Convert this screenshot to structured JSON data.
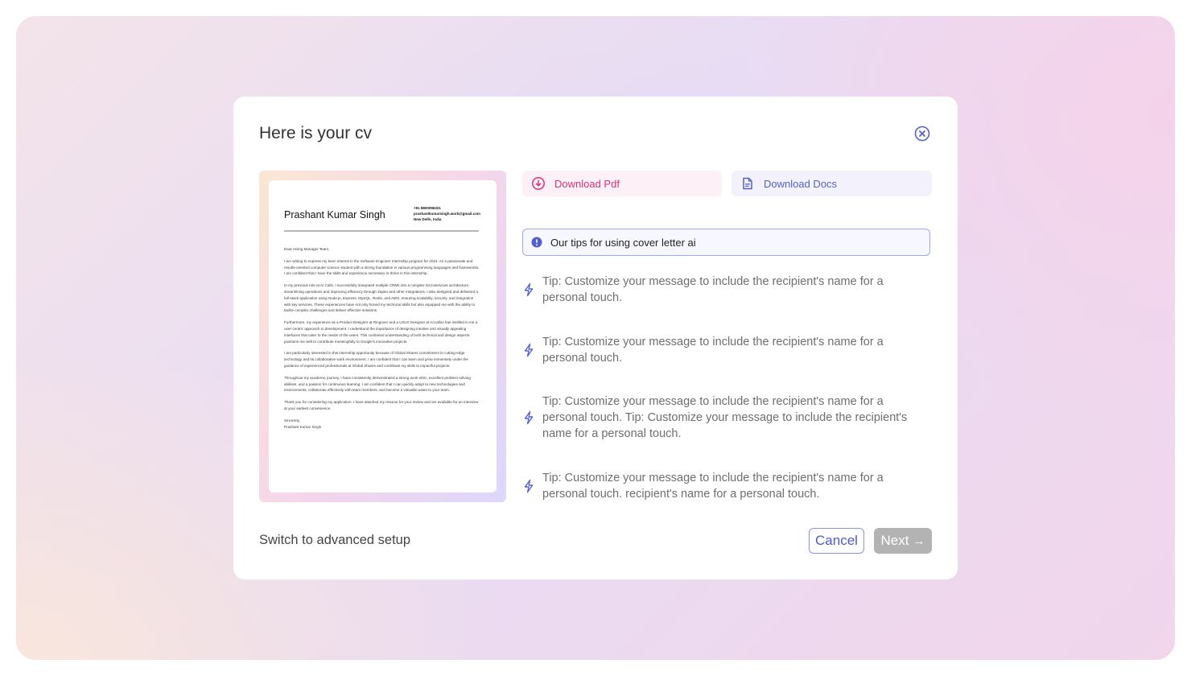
{
  "modal": {
    "title": "Here is your cv"
  },
  "cv_preview": {
    "name": "Prashant Kumar Singh",
    "phone": "+91 8800096321",
    "email": "prashantkumarsingh.work@gmail.com",
    "location": "New Delhi, India",
    "paragraphs": [
      "Dear Hiring Manager Team,",
      "I am writing to express my keen interest in the Software Engineer Internship program for 2024. As a passionate and results-oriented computer science student with a strong foundation in various programming languages and frameworks, I am confident that I have the skills and experience necessary to thrive in this internship.",
      "In my previous role at AI Calls, I successfully integrated multiple CRMs into a complex microservices architecture, streamlining operations and improving efficiency through Zapier and other integrations. I also designed and delivered a full-stack application using Node.js, Express, MySQL, Redis, and AWS, ensuring scalability, security, and integration with key services. These experiences have not only honed my technical skills but also equipped me with the ability to tackle complex challenges and deliver effective solutions.",
      "Furthermore, my experience as a Product Designer at Ringover and a UI/UX Designer at Accolbio has instilled in me a user-centric approach to development. I understand the importance of designing intuitive and visually appealing interfaces that cater to the needs of the users. This combined understanding of both technical and design aspects positions me well to contribute meaningfully to Google's innovative projects.",
      "I am particularly interested in this internship opportunity because of Global Shares commitment to cutting-edge technology and its collaborative work environment. I am confident that I can learn and grow immensely under the guidance of experienced professionals at Global Shares and contribute my skills to impactful projects.",
      "Throughout my academic journey, I have consistently demonstrated a strong work ethic, excellent problem-solving abilities, and a passion for continuous learning. I am confident that I can quickly adapt to new technologies and environments, collaborate effectively with team members, and become a valuable asset to your team.",
      "Thank you for considering my application. I have attached my resume for your review and am available for an interview at your earliest convenience.",
      "Sincerely,\nPrashant Kumar Singh"
    ]
  },
  "downloads": {
    "pdf_label": "Download Pdf",
    "docs_label": "Download Docs"
  },
  "tips": {
    "header": "Our tips for using cover letter ai",
    "items": [
      "Tip: Customize your message to include the recipient's name for a personal touch.",
      "Tip: Customize your message to include the recipient's name for a personal touch.",
      "Tip: Customize your message to include the recipient's name for a personal touch. Tip: Customize your message to include the recipient's name for a personal touch.",
      "Tip: Customize your message to include the recipient's name for a personal touch. recipient's name for a personal touch."
    ]
  },
  "footer": {
    "advanced_link": "Switch to advanced setup",
    "cancel_label": "Cancel",
    "next_label": "Next",
    "next_arrow": "→"
  },
  "icons": {
    "close": "close-circle-icon",
    "pdf": "download-circle-icon",
    "docs": "document-icon",
    "info": "info-icon",
    "tip": "lightning-icon"
  },
  "colors": {
    "accent": "#5561c8",
    "pdf_accent": "#d6337a",
    "next_disabled": "#b3b3b3"
  }
}
